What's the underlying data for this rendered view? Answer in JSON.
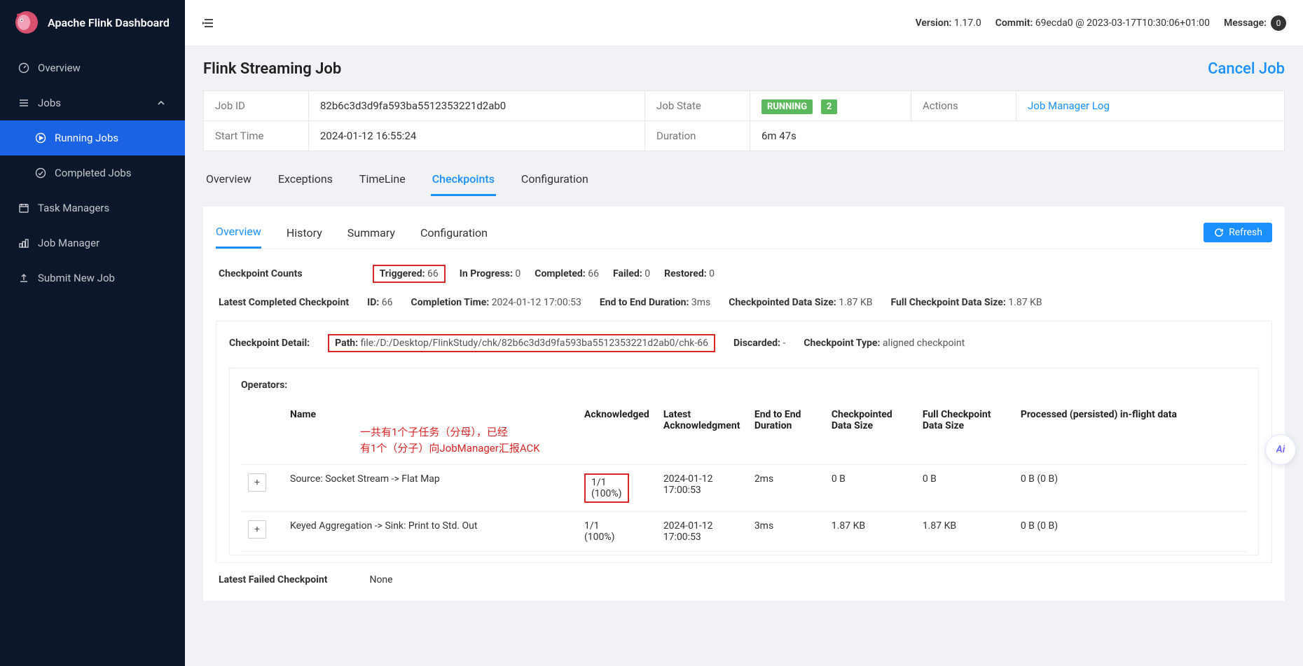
{
  "appTitle": "Apache Flink Dashboard",
  "sidebar": {
    "overview": "Overview",
    "jobs": "Jobs",
    "running": "Running Jobs",
    "completed": "Completed Jobs",
    "tm": "Task Managers",
    "jm": "Job Manager",
    "submit": "Submit New Job"
  },
  "topbar": {
    "versionLabel": "Version:",
    "version": "1.17.0",
    "commitLabel": "Commit:",
    "commit": "69ecda0 @ 2023-03-17T10:30:06+01:00",
    "messageLabel": "Message:",
    "messageCount": "0"
  },
  "page": {
    "title": "Flink Streaming Job",
    "cancel": "Cancel Job"
  },
  "job": {
    "idLabel": "Job ID",
    "idValue": "82b6c3d3d9fa593ba5512353221d2ab0",
    "stateLabel": "Job State",
    "stateValue": "RUNNING",
    "stateNum": "2",
    "actionsLabel": "Actions",
    "jmLog": "Job Manager Log",
    "startLabel": "Start Time",
    "startValue": "2024-01-12 16:55:24",
    "durLabel": "Duration",
    "durValue": "6m 47s"
  },
  "tabs": {
    "overview": "Overview",
    "exceptions": "Exceptions",
    "timeline": "TimeLine",
    "checkpoints": "Checkpoints",
    "config": "Configuration"
  },
  "subtabs": {
    "overview": "Overview",
    "history": "History",
    "summary": "Summary",
    "config": "Configuration",
    "refresh": "Refresh"
  },
  "counts": {
    "head": "Checkpoint Counts",
    "triggered": {
      "k": "Triggered:",
      "v": "66"
    },
    "inprog": {
      "k": "In Progress:",
      "v": "0"
    },
    "completed": {
      "k": "Completed:",
      "v": "66"
    },
    "failed": {
      "k": "Failed:",
      "v": "0"
    },
    "restored": {
      "k": "Restored:",
      "v": "0"
    }
  },
  "latest": {
    "head": "Latest Completed Checkpoint",
    "idK": "ID:",
    "idV": "66",
    "ctK": "Completion Time:",
    "ctV": "2024-01-12 17:00:53",
    "e2eK": "End to End Duration:",
    "e2eV": "3ms",
    "cdsK": "Checkpointed Data Size:",
    "cdsV": "1.87 KB",
    "fdsK": "Full Checkpoint Data Size:",
    "fdsV": "1.87 KB"
  },
  "detail": {
    "head": "Checkpoint Detail:",
    "pathK": "Path:",
    "pathV": "file:/D:/Desktop/FlinkStudy/chk/82b6c3d3d9fa593ba5512353221d2ab0/chk-66",
    "discK": "Discarded:",
    "discV": "-",
    "typeK": "Checkpoint Type:",
    "typeV": "aligned checkpoint"
  },
  "ops": {
    "head": "Operators:",
    "cols": {
      "name": "Name",
      "ack": "Acknowledged",
      "lack": "Latest Acknowledgment",
      "e2e": "End to End Duration",
      "cds": "Checkpointed Data Size",
      "fds": "Full Checkpoint Data Size",
      "pif": "Processed (persisted) in-flight data"
    },
    "annot1": "一共有1个子任务（分母），已经",
    "annot2": "有1个（分子）向JobManager汇报ACK",
    "rows": [
      {
        "name": "Source: Socket Stream -> Flat Map",
        "ack": "1/1 (100%)",
        "lack": "2024-01-12 17:00:53",
        "e2e": "2ms",
        "cds": "0 B",
        "fds": "0 B",
        "pif": "0 B (0 B)"
      },
      {
        "name": "Keyed Aggregation -> Sink: Print to Std. Out",
        "ack": "1/1 (100%)",
        "lack": "2024-01-12 17:00:53",
        "e2e": "3ms",
        "cds": "1.87 KB",
        "fds": "1.87 KB",
        "pif": "0 B (0 B)"
      }
    ]
  },
  "failed": {
    "head": "Latest Failed Checkpoint",
    "val": "None"
  },
  "ai": "Ai"
}
